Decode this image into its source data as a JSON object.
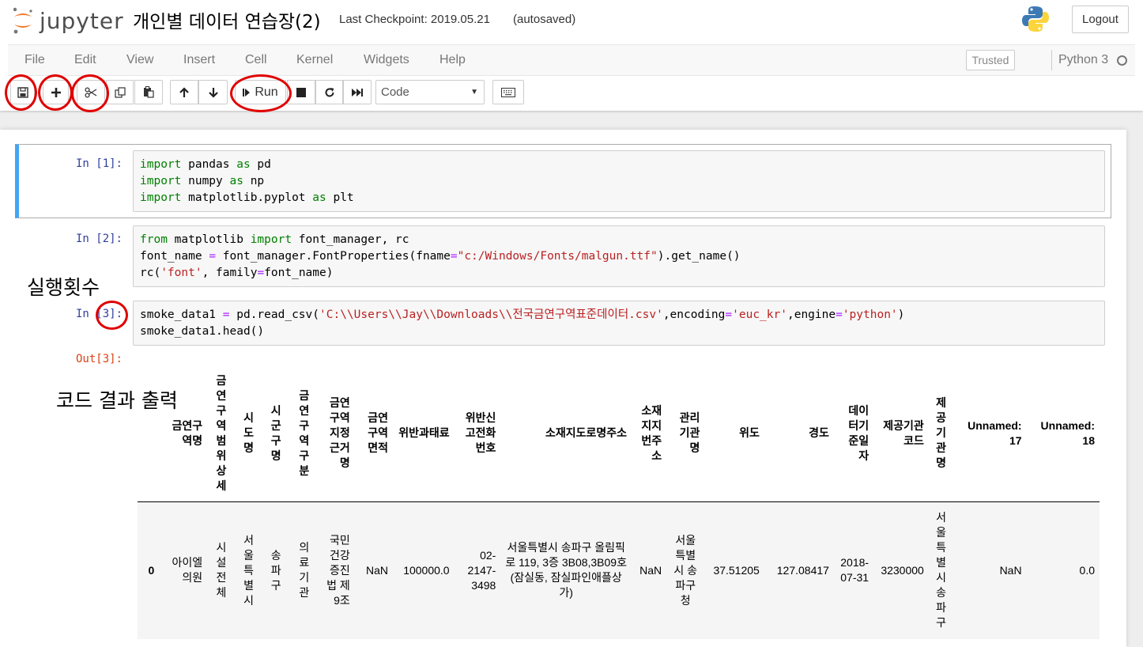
{
  "header": {
    "logo_text": "jupyter",
    "notebook_title": "개인별 데이터 연습장(2)",
    "checkpoint": "Last Checkpoint: 2019.05.21",
    "autosave": "(autosaved)",
    "logout": "Logout"
  },
  "menubar": {
    "items": [
      "File",
      "Edit",
      "View",
      "Insert",
      "Cell",
      "Kernel",
      "Widgets",
      "Help"
    ],
    "trusted": "Trusted",
    "kernel": "Python 3"
  },
  "toolbar": {
    "run_label": "Run",
    "cell_type": "Code",
    "icons": [
      "save-icon",
      "plus-icon",
      "cut-icon",
      "copy-icon",
      "paste-icon",
      "arrow-up-icon",
      "arrow-down-icon",
      "run-icon",
      "stop-icon",
      "restart-icon",
      "fast-forward-icon",
      "keyboard-icon"
    ]
  },
  "cells": [
    {
      "prompt": "In [1]:"
    },
    {
      "prompt": "In [2]:"
    },
    {
      "prompt_in": "In ",
      "prompt_num": "[3]",
      "prompt_colon": ":",
      "out_prompt": "Out[3]:"
    }
  ],
  "annotations": {
    "exec_count": "실행횟수",
    "code_output": "코드 결과 출력"
  },
  "dataframe": {
    "columns": [
      "금연구역명",
      "금연구역범위상세",
      "시도명",
      "시군구명",
      "금연구역구분",
      "금연구역지정근거명",
      "금연구역면적",
      "위반과태료",
      "위반신고전화번호",
      "소재지도로명주소",
      "소재지지번주소",
      "관리기관명",
      "위도",
      "경도",
      "데이터기준일자",
      "제공기관코드",
      "제공기관명",
      "Unnamed: 17",
      "Unnamed: 18"
    ],
    "rows": [
      {
        "index": "0",
        "values": [
          "아이엘의원",
          "시설전체",
          "서울특별시",
          "송파구",
          "의료기관",
          "국민건강증진법 제9조",
          "NaN",
          "100000.0",
          "02-2147-3498",
          "서울특별시 송파구 올림픽로 119, 3증 3B08,3B09호 (잠실동, 잠실파인애플상가)",
          "NaN",
          "서울특별시 송파구청",
          "37.51205",
          "127.08417",
          "2018-07-31",
          "3230000",
          "서울특별시 송파구",
          "NaN",
          "0.0"
        ]
      }
    ]
  },
  "colors": {
    "selected_cell_bar": "#42a5f5",
    "annotation_red": "#e00000",
    "prompt_in": "#303f9f",
    "prompt_out": "#d84315"
  }
}
